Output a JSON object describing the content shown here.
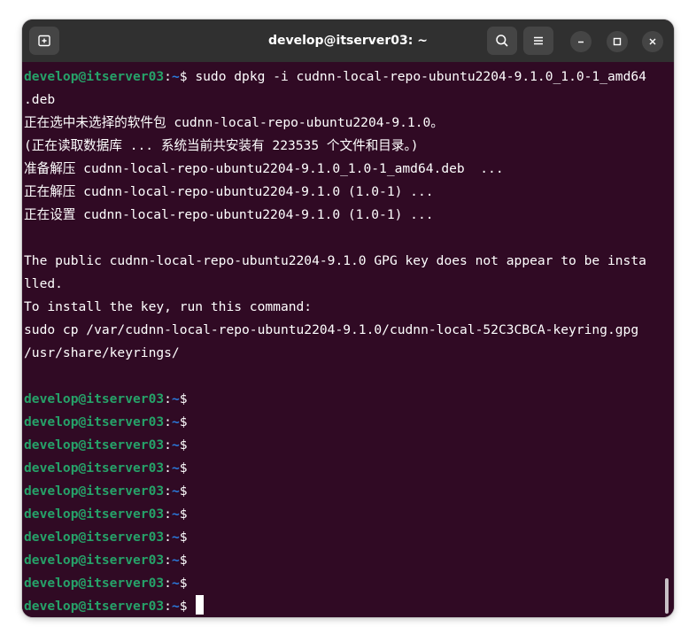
{
  "window": {
    "title": "develop@itserver03: ~"
  },
  "prompt": {
    "user_host": "develop@itserver03",
    "sep": ":",
    "path": "~",
    "symbol": "$"
  },
  "terminal": {
    "command_text": " sudo dpkg -i cudnn-local-repo-ubuntu2204-9.1.0_1.0-1_amd64",
    "lines": [
      ".deb",
      "正在选中未选择的软件包 cudnn-local-repo-ubuntu2204-9.1.0。",
      "(正在读取数据库 ... 系统当前共安装有 223535 个文件和目录。)",
      "准备解压 cudnn-local-repo-ubuntu2204-9.1.0_1.0-1_amd64.deb  ...",
      "正在解压 cudnn-local-repo-ubuntu2204-9.1.0 (1.0-1) ...",
      "正在设置 cudnn-local-repo-ubuntu2204-9.1.0 (1.0-1) ...",
      "",
      "The public cudnn-local-repo-ubuntu2204-9.1.0 GPG key does not appear to be insta",
      "lled.",
      "To install the key, run this command:",
      "sudo cp /var/cudnn-local-repo-ubuntu2204-9.1.0/cudnn-local-52C3CBCA-keyring.gpg",
      "/usr/share/keyrings/",
      ""
    ]
  },
  "icons": {
    "new_tab": "new-tab-icon",
    "search": "search-icon",
    "menu": "hamburger-menu-icon",
    "minimize": "minimize-icon",
    "maximize": "maximize-icon",
    "close": "close-icon"
  },
  "colors": {
    "terminal_bg": "#300a24",
    "titlebar_bg": "#303030",
    "prompt_user": "#26a269",
    "prompt_path": "#2a7bde",
    "text": "#ffffff"
  }
}
